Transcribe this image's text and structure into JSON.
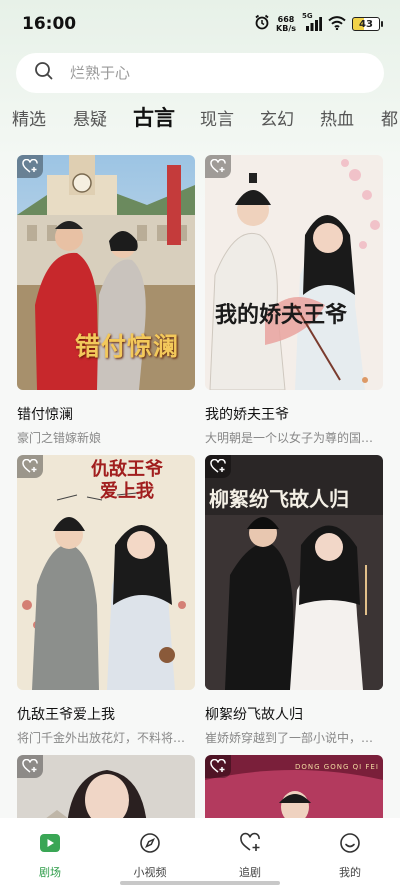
{
  "status_bar": {
    "time": "16:00",
    "net_speed_value": "668",
    "net_speed_unit": "KB/s",
    "network_type": "5G",
    "battery_level": "43",
    "battery_fraction": 0.43
  },
  "search": {
    "placeholder": "烂熟于心"
  },
  "tabs": [
    {
      "label": "精选"
    },
    {
      "label": "悬疑"
    },
    {
      "label": "古言",
      "active": true
    },
    {
      "label": "现言"
    },
    {
      "label": "玄幻"
    },
    {
      "label": "热血"
    },
    {
      "label": "都"
    }
  ],
  "cards": [
    {
      "title": "错付惊澜",
      "desc": "豪门之错嫁新娘",
      "poster_text": "错付惊澜"
    },
    {
      "title": "我的娇夫王爷",
      "desc": "大明朝是一个以女子为尊的国…",
      "poster_text": "我的娇夫王爷"
    },
    {
      "title": "仇敌王爷爱上我",
      "desc": "将门千金外出放花灯，不料将…",
      "poster_text": "仇敌王爷爱上我"
    },
    {
      "title": "柳絮纷飞故人归",
      "desc": "崔娇娇穿越到了一部小说中，…",
      "poster_text": "柳絮纷飞故人归"
    },
    {
      "title": "",
      "desc": ""
    },
    {
      "title": "",
      "desc": "",
      "poster_text": "DONG GONG QI FEI"
    }
  ],
  "bottom_nav": [
    {
      "label": "剧场",
      "icon": "play-icon",
      "active": true
    },
    {
      "label": "小视频",
      "icon": "compass-icon"
    },
    {
      "label": "追剧",
      "icon": "heart-plus-icon"
    },
    {
      "label": "我的",
      "icon": "smile-icon"
    }
  ],
  "colors": {
    "accent": "#2f9e4a",
    "background": "#f4f8f4"
  }
}
